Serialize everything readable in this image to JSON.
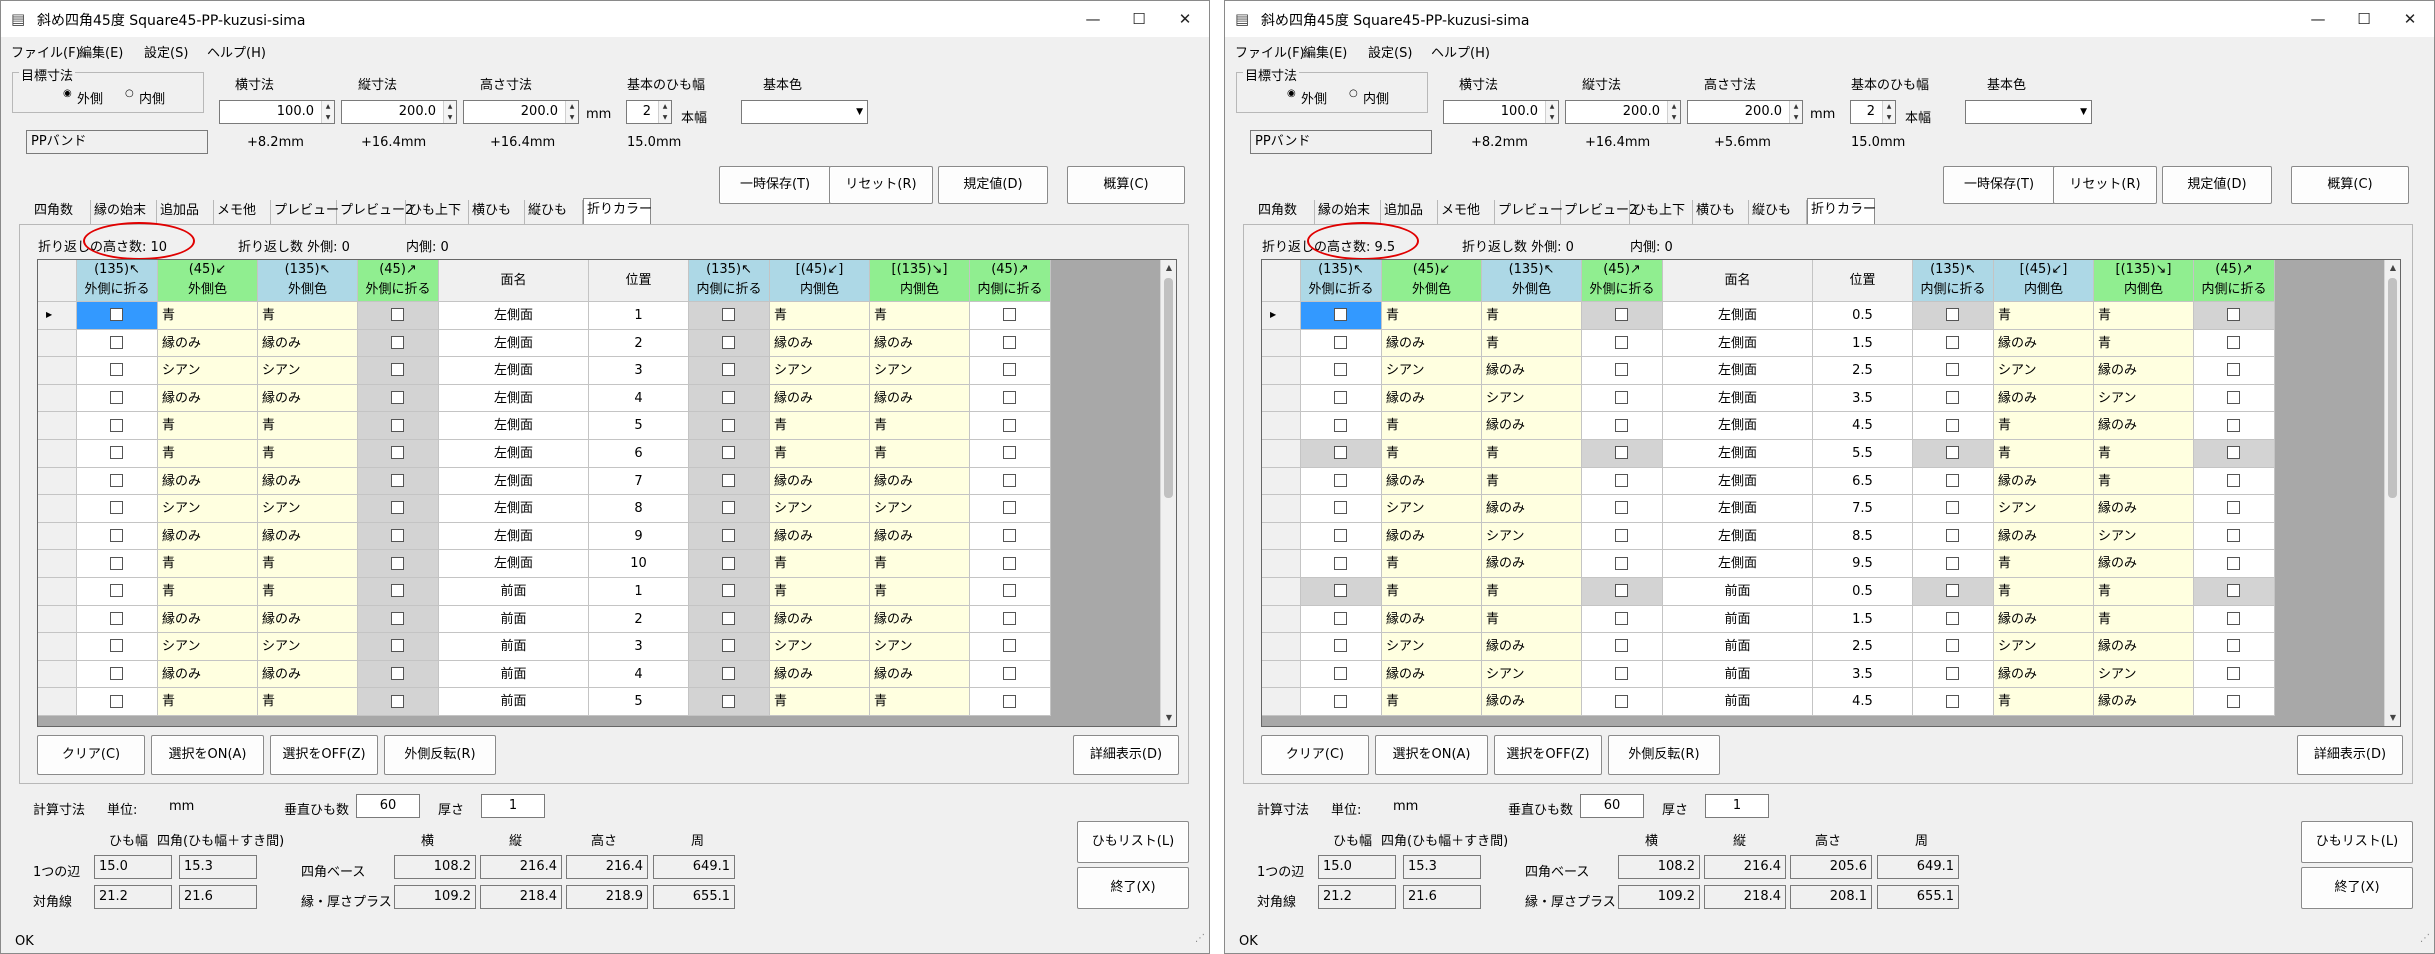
{
  "windows": [
    {
      "title": "斜め四角45度 Square45-PP-kuzusi-sima",
      "menu": [
        "ファイル(F)",
        "編集(E)",
        "設定(S)",
        "ヘルプ(H)"
      ],
      "target": {
        "group_label": "目標寸法",
        "options": [
          "外側",
          "内側"
        ],
        "selected": "外側"
      },
      "dims": {
        "width_label": "横寸法",
        "length_label": "縦寸法",
        "height_label": "高さ寸法",
        "width": "100.0",
        "length": "200.0",
        "height": "200.0",
        "unit": "mm"
      },
      "band": {
        "count_label": "基本のひも幅",
        "count": "2",
        "count_unit": "本幅",
        "color_label": "基本色",
        "color": ""
      },
      "band_name": "PPバンド",
      "offsets": {
        "width": "+8.2mm",
        "length": "+16.4mm",
        "height": "+16.4mm",
        "band_width": "15.0mm"
      },
      "action_buttons": [
        "一時保存(T)",
        "リセット(R)",
        "規定値(D)",
        "概算(C)"
      ],
      "tabs": [
        "四角数",
        "縁の始末",
        "追加品",
        "メモ他",
        "プレビュー",
        "プレビュー2",
        "ひも上下",
        "横ひも",
        "縦ひも",
        "折りカラー"
      ],
      "active_tab": "折りカラー",
      "fold": {
        "height_text": "折り返しの高さ数: 10",
        "outer_text": "折り返し数 外側:  0",
        "inner_text": "内側:  0"
      },
      "columns": [
        "(135)↖\n外側に折る",
        "(45)↙\n外側色",
        "(135)↖\n外側色",
        "(45)↗\n外側に折る",
        "面名",
        "位置",
        "(135)↖\n内側に折る",
        "[(45)↙]\n内側色",
        "[(135)↘]\n内側色",
        "(45)↗\n内側に折る"
      ],
      "rows": [
        [
          "",
          "青",
          "青",
          "",
          "左側面",
          "1",
          "",
          "青",
          "青",
          ""
        ],
        [
          "",
          "縁のみ",
          "縁のみ",
          "",
          "左側面",
          "2",
          "",
          "縁のみ",
          "縁のみ",
          ""
        ],
        [
          "",
          "シアン",
          "シアン",
          "",
          "左側面",
          "3",
          "",
          "シアン",
          "シアン",
          ""
        ],
        [
          "",
          "縁のみ",
          "縁のみ",
          "",
          "左側面",
          "4",
          "",
          "縁のみ",
          "縁のみ",
          ""
        ],
        [
          "",
          "青",
          "青",
          "",
          "左側面",
          "5",
          "",
          "青",
          "青",
          ""
        ],
        [
          "",
          "青",
          "青",
          "",
          "左側面",
          "6",
          "",
          "青",
          "青",
          ""
        ],
        [
          "",
          "縁のみ",
          "縁のみ",
          "",
          "左側面",
          "7",
          "",
          "縁のみ",
          "縁のみ",
          ""
        ],
        [
          "",
          "シアン",
          "シアン",
          "",
          "左側面",
          "8",
          "",
          "シアン",
          "シアン",
          ""
        ],
        [
          "",
          "縁のみ",
          "縁のみ",
          "",
          "左側面",
          "9",
          "",
          "縁のみ",
          "縁のみ",
          ""
        ],
        [
          "",
          "青",
          "青",
          "",
          "左側面",
          "10",
          "",
          "青",
          "青",
          ""
        ],
        [
          "",
          "青",
          "青",
          "",
          "前面",
          "1",
          "",
          "青",
          "青",
          ""
        ],
        [
          "",
          "縁のみ",
          "縁のみ",
          "",
          "前面",
          "2",
          "",
          "縁のみ",
          "縁のみ",
          ""
        ],
        [
          "",
          "シアン",
          "シアン",
          "",
          "前面",
          "3",
          "",
          "シアン",
          "シアン",
          ""
        ],
        [
          "",
          "縁のみ",
          "縁のみ",
          "",
          "前面",
          "4",
          "",
          "縁のみ",
          "縁のみ",
          ""
        ],
        [
          "",
          "青",
          "青",
          "",
          "前面",
          "5",
          "",
          "青",
          "青",
          ""
        ]
      ],
      "gray_rows": [],
      "bottom_buttons": [
        "クリア(C)",
        "選択をON(A)",
        "選択をOFF(Z)",
        "外側反転(R)"
      ],
      "detail_button": "詳細表示(D)",
      "calc": {
        "label": "計算寸法",
        "unit_label": "単位:",
        "unit": "mm",
        "vert_label": "垂直ひも数",
        "vert": "60",
        "thick_label": "厚さ",
        "thick": "1",
        "band_w_label": "ひも幅",
        "square_label": "四角(ひも幅＋すき間)",
        "col_w": "横",
        "col_l": "縦",
        "col_h": "高さ",
        "col_p": "周",
        "side_label": "1つの辺",
        "diag_label": "対角線",
        "side_w": "15.0",
        "side_s": "15.3",
        "diag_w": "21.2",
        "diag_s": "21.6",
        "base_label": "四角ベース",
        "plus_label": "縁・厚さプラス",
        "base": [
          "108.2",
          "216.4",
          "216.4",
          "649.1"
        ],
        "plus": [
          "109.2",
          "218.4",
          "218.9",
          "655.1"
        ]
      },
      "list_button": "ひもリスト(L)",
      "exit_button": "終了(X)",
      "status": "OK"
    },
    {
      "title": "斜め四角45度 Square45-PP-kuzusi-sima",
      "menu": [
        "ファイル(F)",
        "編集(E)",
        "設定(S)",
        "ヘルプ(H)"
      ],
      "target": {
        "group_label": "目標寸法",
        "options": [
          "外側",
          "内側"
        ],
        "selected": "外側"
      },
      "dims": {
        "width_label": "横寸法",
        "length_label": "縦寸法",
        "height_label": "高さ寸法",
        "width": "100.0",
        "length": "200.0",
        "height": "200.0",
        "unit": "mm"
      },
      "band": {
        "count_label": "基本のひも幅",
        "count": "2",
        "count_unit": "本幅",
        "color_label": "基本色",
        "color": ""
      },
      "band_name": "PPバンド",
      "offsets": {
        "width": "+8.2mm",
        "length": "+16.4mm",
        "height": "+5.6mm",
        "band_width": "15.0mm"
      },
      "action_buttons": [
        "一時保存(T)",
        "リセット(R)",
        "規定値(D)",
        "概算(C)"
      ],
      "tabs": [
        "四角数",
        "縁の始末",
        "追加品",
        "メモ他",
        "プレビュー",
        "プレビュー2",
        "ひも上下",
        "横ひも",
        "縦ひも",
        "折りカラー"
      ],
      "active_tab": "折りカラー",
      "fold": {
        "height_text": "折り返しの高さ数: 9.5",
        "outer_text": "折り返し数 外側:  0",
        "inner_text": "内側:  0"
      },
      "columns": [
        "(135)↖\n外側に折る",
        "(45)↙\n外側色",
        "(135)↖\n外側色",
        "(45)↗\n外側に折る",
        "面名",
        "位置",
        "(135)↖\n内側に折る",
        "[(45)↙]\n内側色",
        "[(135)↘]\n内側色",
        "(45)↗\n内側に折る"
      ],
      "rows": [
        [
          "",
          "青",
          "青",
          "",
          "左側面",
          "0.5",
          "",
          "青",
          "青",
          ""
        ],
        [
          "",
          "縁のみ",
          "青",
          "",
          "左側面",
          "1.5",
          "",
          "縁のみ",
          "青",
          ""
        ],
        [
          "",
          "シアン",
          "縁のみ",
          "",
          "左側面",
          "2.5",
          "",
          "シアン",
          "縁のみ",
          ""
        ],
        [
          "",
          "縁のみ",
          "シアン",
          "",
          "左側面",
          "3.5",
          "",
          "縁のみ",
          "シアン",
          ""
        ],
        [
          "",
          "青",
          "縁のみ",
          "",
          "左側面",
          "4.5",
          "",
          "青",
          "縁のみ",
          ""
        ],
        [
          "",
          "青",
          "青",
          "",
          "左側面",
          "5.5",
          "",
          "青",
          "青",
          ""
        ],
        [
          "",
          "縁のみ",
          "青",
          "",
          "左側面",
          "6.5",
          "",
          "縁のみ",
          "青",
          ""
        ],
        [
          "",
          "シアン",
          "縁のみ",
          "",
          "左側面",
          "7.5",
          "",
          "シアン",
          "縁のみ",
          ""
        ],
        [
          "",
          "縁のみ",
          "シアン",
          "",
          "左側面",
          "8.5",
          "",
          "縁のみ",
          "シアン",
          ""
        ],
        [
          "",
          "青",
          "縁のみ",
          "",
          "左側面",
          "9.5",
          "",
          "青",
          "縁のみ",
          ""
        ],
        [
          "",
          "青",
          "青",
          "",
          "前面",
          "0.5",
          "",
          "青",
          "青",
          ""
        ],
        [
          "",
          "縁のみ",
          "青",
          "",
          "前面",
          "1.5",
          "",
          "縁のみ",
          "青",
          ""
        ],
        [
          "",
          "シアン",
          "縁のみ",
          "",
          "前面",
          "2.5",
          "",
          "シアン",
          "縁のみ",
          ""
        ],
        [
          "",
          "縁のみ",
          "シアン",
          "",
          "前面",
          "3.5",
          "",
          "縁のみ",
          "シアン",
          ""
        ],
        [
          "",
          "青",
          "縁のみ",
          "",
          "前面",
          "4.5",
          "",
          "青",
          "縁のみ",
          ""
        ]
      ],
      "gray_rows": [
        0,
        5,
        10
      ],
      "bottom_buttons": [
        "クリア(C)",
        "選択をON(A)",
        "選択をOFF(Z)",
        "外側反転(R)"
      ],
      "detail_button": "詳細表示(D)",
      "calc": {
        "label": "計算寸法",
        "unit_label": "単位:",
        "unit": "mm",
        "vert_label": "垂直ひも数",
        "vert": "60",
        "thick_label": "厚さ",
        "thick": "1",
        "band_w_label": "ひも幅",
        "square_label": "四角(ひも幅＋すき間)",
        "col_w": "横",
        "col_l": "縦",
        "col_h": "高さ",
        "col_p": "周",
        "side_label": "1つの辺",
        "diag_label": "対角線",
        "side_w": "15.0",
        "side_s": "15.3",
        "diag_w": "21.2",
        "diag_s": "21.6",
        "base_label": "四角ベース",
        "plus_label": "縁・厚さプラス",
        "base": [
          "108.2",
          "216.4",
          "205.6",
          "649.1"
        ],
        "plus": [
          "109.2",
          "218.4",
          "208.1",
          "655.1"
        ]
      },
      "list_button": "ひもリスト(L)",
      "exit_button": "終了(X)",
      "status": "OK"
    }
  ],
  "colors": {
    "header_blue": "#add8e6",
    "header_green": "#90ee90",
    "cell_yellow": "#ffffe0",
    "cell_gray": "#d3d3d3",
    "highlight": "#3399ff",
    "annotation": "#e00000"
  }
}
